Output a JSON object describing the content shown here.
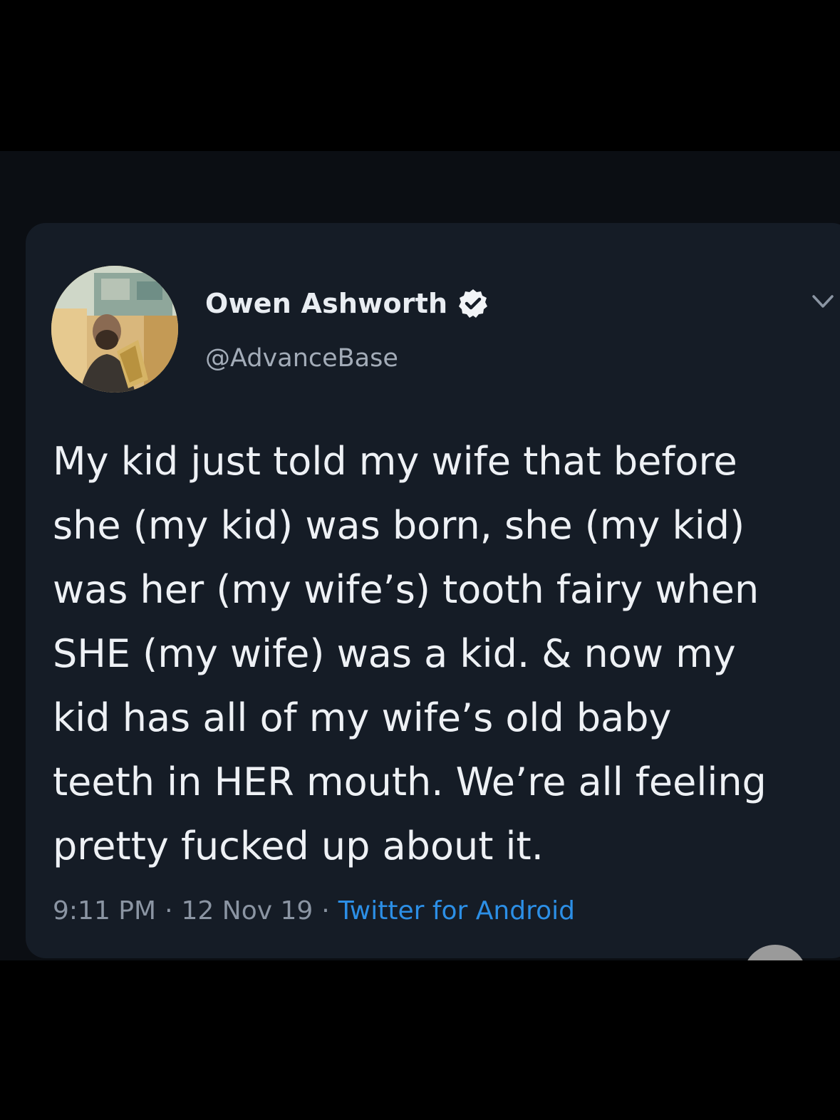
{
  "tweet": {
    "author": {
      "display_name": "Owen Ashworth",
      "handle": "@AdvanceBase",
      "verified": true,
      "avatar_icon": "profile-photo"
    },
    "text": "My kid just told my wife that before\nshe (my kid) was born, she (my kid)\nwas her (my wife’s) tooth fairy when\nSHE (my wife) was a kid. & now my\nkid has all of my wife’s old baby\nteeth in HER mouth. We’re all feeling\npretty fucked up about it.",
    "time": "9:11 PM",
    "date": "12 Nov 19",
    "separator": "·",
    "source": "Twitter for Android",
    "menu_icon": "chevron-down-icon"
  },
  "colors": {
    "background": "#000000",
    "card": "#151c26",
    "text": "#eef1f5",
    "muted": "#8b95a3",
    "link": "#2c8fe6"
  }
}
